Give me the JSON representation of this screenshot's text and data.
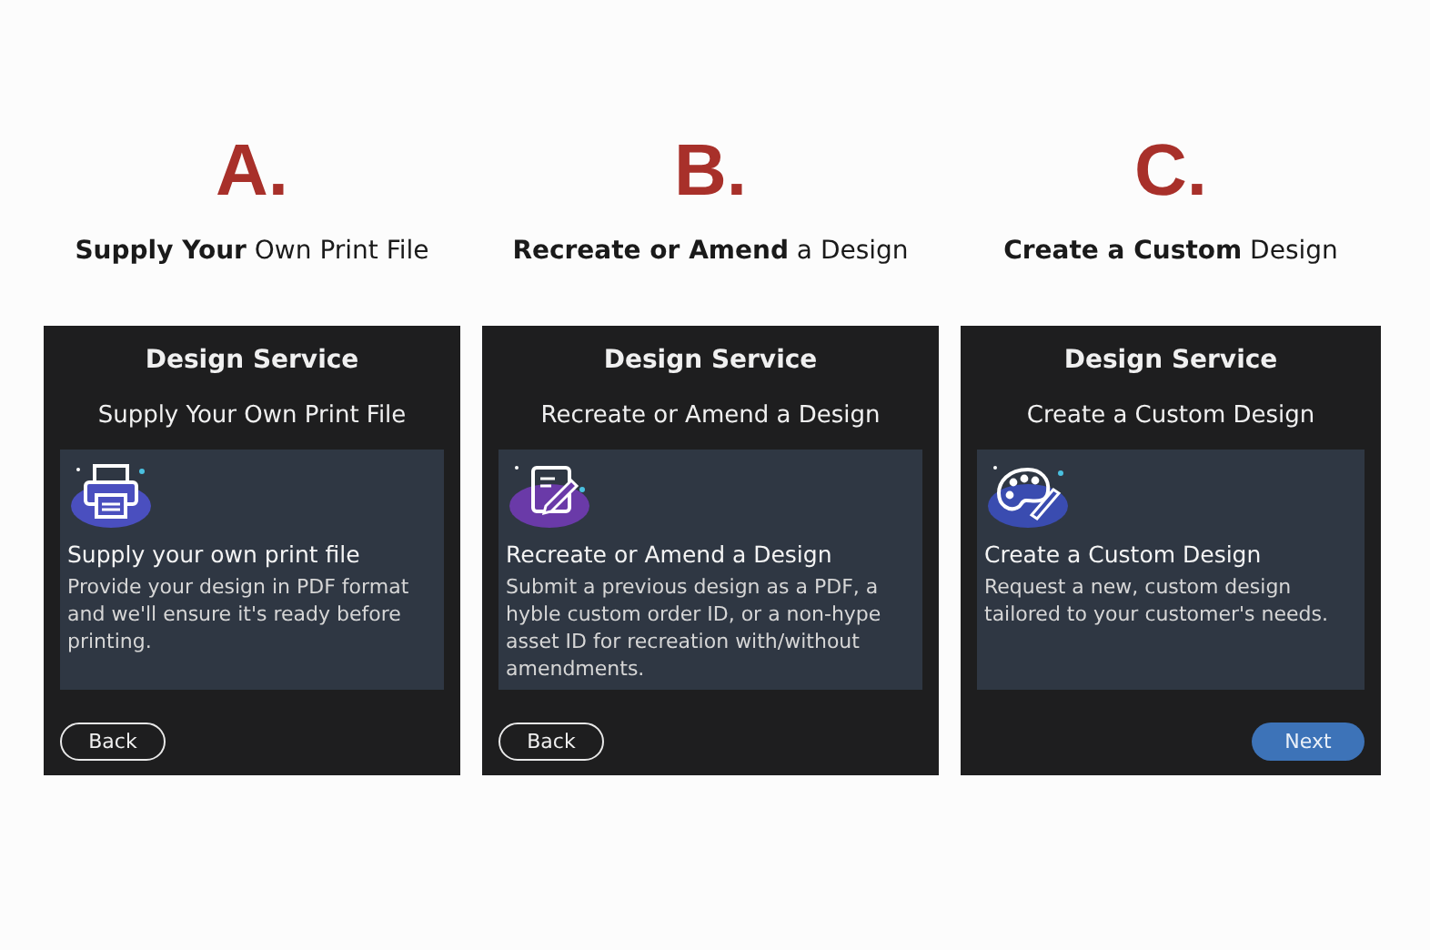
{
  "options": [
    {
      "letter": "A.",
      "caption": "**Supply Your** Own Print File",
      "card": {
        "title": "Design Service",
        "subtitle": "Supply Your Own Print File",
        "heading": "Supply your own print file",
        "description": "Provide your design in PDF format and we'll ensure it's ready before printing.",
        "button": {
          "kind": "back",
          "label": "Back"
        }
      }
    },
    {
      "letter": "B.",
      "caption": "**Recreate or Amend** a Design",
      "card": {
        "title": "Design Service",
        "subtitle": "Recreate or Amend a Design",
        "heading": "Recreate or Amend a Design",
        "description": "Submit a previous design as a PDF, a hyble custom order ID, or a non-hype asset ID for recreation with/without amendments.",
        "button": {
          "kind": "back",
          "label": "Back"
        }
      }
    },
    {
      "letter": "C.",
      "caption": "**Create a Custom** Design",
      "card": {
        "title": "Design Service",
        "subtitle": "Create a Custom Design",
        "heading": "Create a Custom Design",
        "description": "Request a new, custom design tailored to your customer's needs.",
        "button": {
          "kind": "next",
          "label": "Next"
        }
      }
    }
  ]
}
